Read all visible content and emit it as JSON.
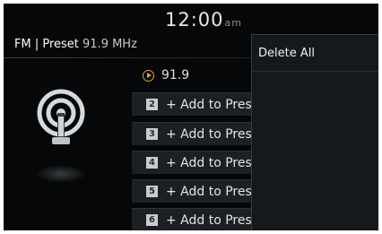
{
  "clock": {
    "time": "12:00",
    "ampm": "am"
  },
  "mode": {
    "band_preset": "FM | Preset",
    "frequency": "91.9 MHz"
  },
  "now_playing": {
    "icon": "play-circle-icon",
    "label": "91.9"
  },
  "presets": [
    {
      "number": "2",
      "label": "+ Add to Preset"
    },
    {
      "number": "3",
      "label": "+ Add to Preset"
    },
    {
      "number": "4",
      "label": "+ Add to Preset"
    },
    {
      "number": "5",
      "label": "+ Add to Preset"
    },
    {
      "number": "6",
      "label": "+ Add to Preset"
    }
  ],
  "popup_menu": {
    "items": [
      {
        "label": "Delete All"
      }
    ]
  },
  "colors": {
    "accent": "#e6a232",
    "background": "#050708",
    "menu_background": "#16191c"
  }
}
